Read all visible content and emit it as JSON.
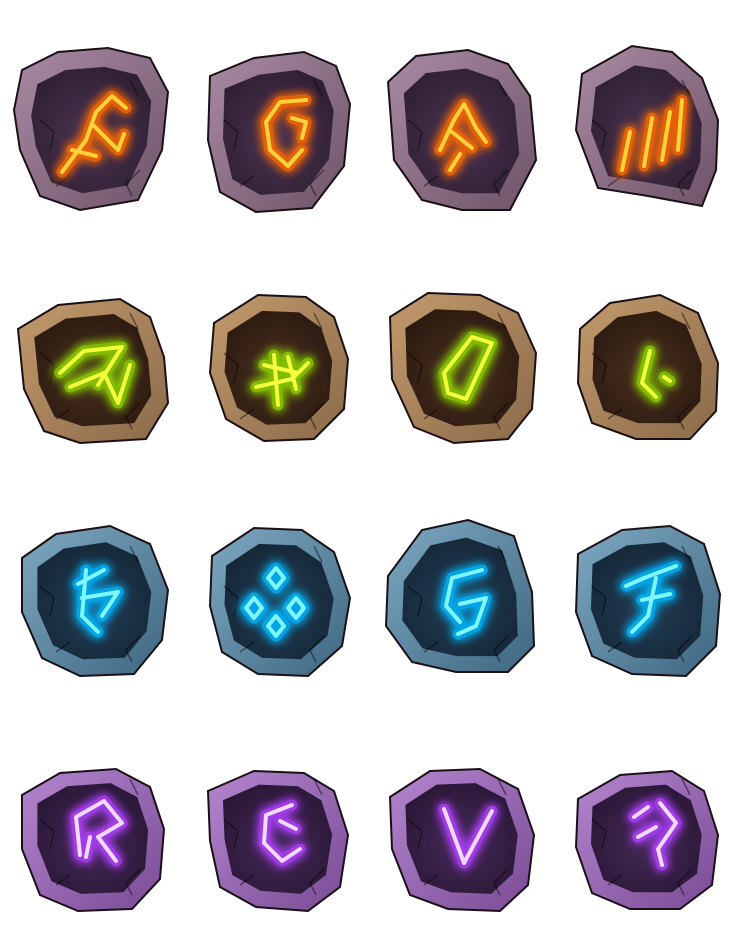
{
  "sheet": {
    "rows": [
      {
        "set": "fire",
        "rim": "#6e5468",
        "rim_light": "#a98aa3",
        "face": "#2f1f34",
        "face_light": "#4c3550",
        "glow": "#ff6a00",
        "core": "#ffd23a",
        "runes": [
          "fire-rune-1",
          "fire-rune-2",
          "fire-rune-3",
          "fire-rune-4"
        ]
      },
      {
        "set": "earth",
        "rim": "#8a6a4a",
        "rim_light": "#c39a6c",
        "face": "#2c1a10",
        "face_light": "#4a3020",
        "glow": "#8fd400",
        "core": "#f1ff3c",
        "runes": [
          "earth-rune-1",
          "earth-rune-2",
          "earth-rune-3",
          "earth-rune-4"
        ]
      },
      {
        "set": "water",
        "rim": "#3e6680",
        "rim_light": "#7fa9c2",
        "face": "#152738",
        "face_light": "#223e55",
        "glow": "#00b7ff",
        "core": "#7ff6ff",
        "runes": [
          "water-rune-1",
          "water-rune-2",
          "water-rune-3",
          "water-rune-4"
        ]
      },
      {
        "set": "arcane",
        "rim": "#7a4b95",
        "rim_light": "#b486cf",
        "face": "#2a1736",
        "face_light": "#452a58",
        "glow": "#b040ff",
        "core": "#f2d9ff",
        "runes": [
          "arcane-rune-1",
          "arcane-rune-2",
          "arcane-rune-3",
          "arcane-rune-4"
        ]
      }
    ]
  }
}
